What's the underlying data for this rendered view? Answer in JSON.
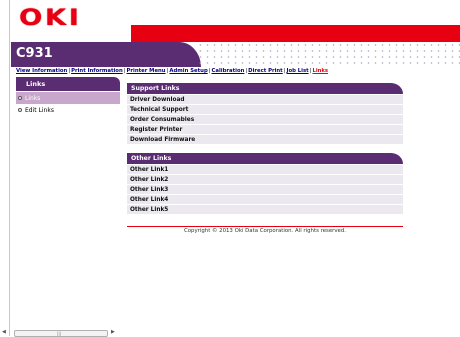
{
  "brand": {
    "logo": "OKI"
  },
  "model": {
    "name": "C931"
  },
  "nav": {
    "items": [
      {
        "label": "View Information",
        "current": false
      },
      {
        "label": "Print Information",
        "current": false
      },
      {
        "label": "Printer Menu",
        "current": false
      },
      {
        "label": "Admin Setup",
        "current": false
      },
      {
        "label": "Calibration",
        "current": false
      },
      {
        "label": "Direct Print",
        "current": false
      },
      {
        "label": "Job List",
        "current": false
      },
      {
        "label": "Links",
        "current": true
      }
    ],
    "separator": "|"
  },
  "sidebar": {
    "title": "Links",
    "items": [
      {
        "label": "Links",
        "selected": true
      },
      {
        "label": "Edit Links",
        "selected": false
      }
    ]
  },
  "support": {
    "title": "Support Links",
    "items": [
      "Driver Download",
      "Technical Support",
      "Order Consumables",
      "Register Printer",
      "Download Firmware"
    ]
  },
  "other": {
    "title": "Other Links",
    "items": [
      "Other Link1",
      "Other Link2",
      "Other Link3",
      "Other Link4",
      "Other Link5"
    ]
  },
  "footer": {
    "copyright": "Copyright © 2013 Oki Data Corporation. All rights reserved."
  },
  "colors": {
    "brand_red": "#e60012",
    "purple": "#5a2d73",
    "selected": "#c9a6cb",
    "row_bg": "#ebe8ef"
  }
}
